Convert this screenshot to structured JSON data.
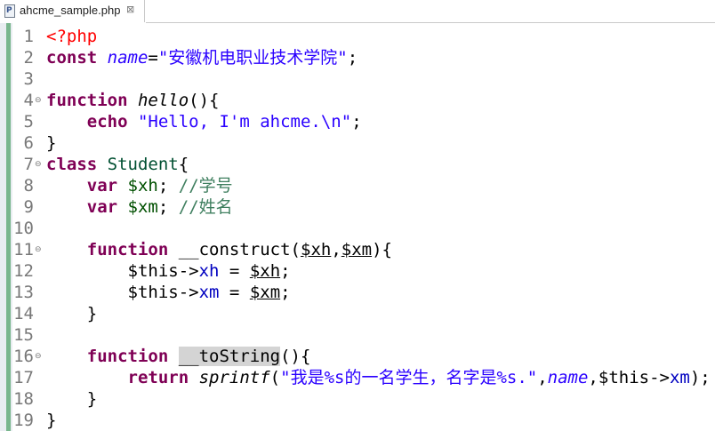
{
  "tab": {
    "icon": "php-file-icon",
    "icon_letter": "P",
    "title": "ahcme_sample.php",
    "close": "⊠"
  },
  "editor": {
    "lines": [
      {
        "n": "1",
        "fold": "",
        "tokens": [
          {
            "t": "<?php",
            "c": "tag"
          }
        ]
      },
      {
        "n": "2",
        "fold": "",
        "tokens": [
          {
            "t": "const ",
            "c": "kw"
          },
          {
            "t": "name",
            "c": "const"
          },
          {
            "t": "=",
            "c": ""
          },
          {
            "t": "\"安徽机电职业技术学院\"",
            "c": "str"
          },
          {
            "t": ";",
            "c": ""
          }
        ]
      },
      {
        "n": "3",
        "fold": "",
        "tokens": []
      },
      {
        "n": "4",
        "fold": "⊖",
        "tokens": [
          {
            "t": "function ",
            "c": "kw"
          },
          {
            "t": "hello",
            "c": "fn"
          },
          {
            "t": "(){",
            "c": ""
          }
        ]
      },
      {
        "n": "5",
        "fold": "",
        "tokens": [
          {
            "t": "    ",
            "c": ""
          },
          {
            "t": "echo ",
            "c": "kw"
          },
          {
            "t": "\"Hello, I'm ahcme.\\n\"",
            "c": "str"
          },
          {
            "t": ";",
            "c": ""
          }
        ]
      },
      {
        "n": "6",
        "fold": "",
        "tokens": [
          {
            "t": "}",
            "c": ""
          }
        ]
      },
      {
        "n": "7",
        "fold": "⊖",
        "tokens": [
          {
            "t": "class ",
            "c": "kw"
          },
          {
            "t": "Student",
            "c": "cls"
          },
          {
            "t": "{",
            "c": ""
          }
        ]
      },
      {
        "n": "8",
        "fold": "",
        "tokens": [
          {
            "t": "    ",
            "c": ""
          },
          {
            "t": "var ",
            "c": "kw"
          },
          {
            "t": "$xh",
            "c": "var"
          },
          {
            "t": "; ",
            "c": ""
          },
          {
            "t": "//学号",
            "c": "cmt"
          }
        ]
      },
      {
        "n": "9",
        "fold": "",
        "tokens": [
          {
            "t": "    ",
            "c": ""
          },
          {
            "t": "var ",
            "c": "kw"
          },
          {
            "t": "$xm",
            "c": "var"
          },
          {
            "t": "; ",
            "c": ""
          },
          {
            "t": "//姓名",
            "c": "cmt"
          }
        ]
      },
      {
        "n": "10",
        "fold": "",
        "tokens": []
      },
      {
        "n": "11",
        "fold": "⊖",
        "tokens": [
          {
            "t": "    ",
            "c": ""
          },
          {
            "t": "function ",
            "c": "kw"
          },
          {
            "t": "__construct(",
            "c": ""
          },
          {
            "t": "$xh",
            "c": "u"
          },
          {
            "t": ",",
            "c": ""
          },
          {
            "t": "$xm",
            "c": "u"
          },
          {
            "t": "){",
            "c": ""
          }
        ]
      },
      {
        "n": "12",
        "fold": "",
        "tokens": [
          {
            "t": "        ",
            "c": ""
          },
          {
            "t": "$this->",
            "c": ""
          },
          {
            "t": "xh",
            "c": "prop"
          },
          {
            "t": " = ",
            "c": ""
          },
          {
            "t": "$xh",
            "c": "u"
          },
          {
            "t": ";",
            "c": ""
          }
        ]
      },
      {
        "n": "13",
        "fold": "",
        "tokens": [
          {
            "t": "        ",
            "c": ""
          },
          {
            "t": "$this->",
            "c": ""
          },
          {
            "t": "xm",
            "c": "prop"
          },
          {
            "t": " = ",
            "c": ""
          },
          {
            "t": "$xm",
            "c": "u"
          },
          {
            "t": ";",
            "c": ""
          }
        ]
      },
      {
        "n": "14",
        "fold": "",
        "tokens": [
          {
            "t": "    ",
            "c": ""
          },
          {
            "t": "}",
            "c": ""
          }
        ]
      },
      {
        "n": "15",
        "fold": "",
        "tokens": []
      },
      {
        "n": "16",
        "fold": "⊖",
        "tokens": [
          {
            "t": "    ",
            "c": ""
          },
          {
            "t": "function ",
            "c": "kw"
          },
          {
            "t": "__toString",
            "c": "hl"
          },
          {
            "t": "(){",
            "c": ""
          }
        ]
      },
      {
        "n": "17",
        "fold": "",
        "tokens": [
          {
            "t": "        ",
            "c": ""
          },
          {
            "t": "return ",
            "c": "kw"
          },
          {
            "t": "sprintf",
            "c": "fn"
          },
          {
            "t": "(",
            "c": ""
          },
          {
            "t": "\"我是%s的一名学生，名字是%s.\"",
            "c": "str"
          },
          {
            "t": ",",
            "c": ""
          },
          {
            "t": "name",
            "c": "const"
          },
          {
            "t": ",",
            "c": ""
          },
          {
            "t": "$this->",
            "c": ""
          },
          {
            "t": "xm",
            "c": "prop"
          },
          {
            "t": ");",
            "c": ""
          }
        ]
      },
      {
        "n": "18",
        "fold": "",
        "tokens": [
          {
            "t": "    ",
            "c": ""
          },
          {
            "t": "}",
            "c": ""
          }
        ]
      },
      {
        "n": "19",
        "fold": "",
        "tokens": [
          {
            "t": "}",
            "c": ""
          }
        ]
      }
    ]
  }
}
